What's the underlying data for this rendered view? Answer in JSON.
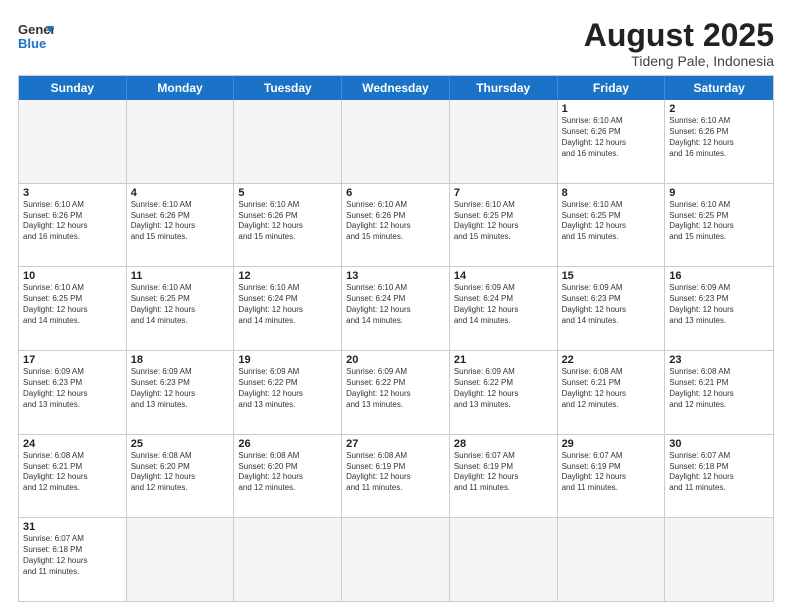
{
  "header": {
    "logo_general": "General",
    "logo_blue": "Blue",
    "month": "August 2025",
    "location": "Tideng Pale, Indonesia"
  },
  "weekdays": [
    "Sunday",
    "Monday",
    "Tuesday",
    "Wednesday",
    "Thursday",
    "Friday",
    "Saturday"
  ],
  "weeks": [
    [
      {
        "day": "",
        "info": ""
      },
      {
        "day": "",
        "info": ""
      },
      {
        "day": "",
        "info": ""
      },
      {
        "day": "",
        "info": ""
      },
      {
        "day": "",
        "info": ""
      },
      {
        "day": "1",
        "info": "Sunrise: 6:10 AM\nSunset: 6:26 PM\nDaylight: 12 hours\nand 16 minutes."
      },
      {
        "day": "2",
        "info": "Sunrise: 6:10 AM\nSunset: 6:26 PM\nDaylight: 12 hours\nand 16 minutes."
      }
    ],
    [
      {
        "day": "3",
        "info": "Sunrise: 6:10 AM\nSunset: 6:26 PM\nDaylight: 12 hours\nand 16 minutes."
      },
      {
        "day": "4",
        "info": "Sunrise: 6:10 AM\nSunset: 6:26 PM\nDaylight: 12 hours\nand 15 minutes."
      },
      {
        "day": "5",
        "info": "Sunrise: 6:10 AM\nSunset: 6:26 PM\nDaylight: 12 hours\nand 15 minutes."
      },
      {
        "day": "6",
        "info": "Sunrise: 6:10 AM\nSunset: 6:26 PM\nDaylight: 12 hours\nand 15 minutes."
      },
      {
        "day": "7",
        "info": "Sunrise: 6:10 AM\nSunset: 6:25 PM\nDaylight: 12 hours\nand 15 minutes."
      },
      {
        "day": "8",
        "info": "Sunrise: 6:10 AM\nSunset: 6:25 PM\nDaylight: 12 hours\nand 15 minutes."
      },
      {
        "day": "9",
        "info": "Sunrise: 6:10 AM\nSunset: 6:25 PM\nDaylight: 12 hours\nand 15 minutes."
      }
    ],
    [
      {
        "day": "10",
        "info": "Sunrise: 6:10 AM\nSunset: 6:25 PM\nDaylight: 12 hours\nand 14 minutes."
      },
      {
        "day": "11",
        "info": "Sunrise: 6:10 AM\nSunset: 6:25 PM\nDaylight: 12 hours\nand 14 minutes."
      },
      {
        "day": "12",
        "info": "Sunrise: 6:10 AM\nSunset: 6:24 PM\nDaylight: 12 hours\nand 14 minutes."
      },
      {
        "day": "13",
        "info": "Sunrise: 6:10 AM\nSunset: 6:24 PM\nDaylight: 12 hours\nand 14 minutes."
      },
      {
        "day": "14",
        "info": "Sunrise: 6:09 AM\nSunset: 6:24 PM\nDaylight: 12 hours\nand 14 minutes."
      },
      {
        "day": "15",
        "info": "Sunrise: 6:09 AM\nSunset: 6:23 PM\nDaylight: 12 hours\nand 14 minutes."
      },
      {
        "day": "16",
        "info": "Sunrise: 6:09 AM\nSunset: 6:23 PM\nDaylight: 12 hours\nand 13 minutes."
      }
    ],
    [
      {
        "day": "17",
        "info": "Sunrise: 6:09 AM\nSunset: 6:23 PM\nDaylight: 12 hours\nand 13 minutes."
      },
      {
        "day": "18",
        "info": "Sunrise: 6:09 AM\nSunset: 6:23 PM\nDaylight: 12 hours\nand 13 minutes."
      },
      {
        "day": "19",
        "info": "Sunrise: 6:09 AM\nSunset: 6:22 PM\nDaylight: 12 hours\nand 13 minutes."
      },
      {
        "day": "20",
        "info": "Sunrise: 6:09 AM\nSunset: 6:22 PM\nDaylight: 12 hours\nand 13 minutes."
      },
      {
        "day": "21",
        "info": "Sunrise: 6:09 AM\nSunset: 6:22 PM\nDaylight: 12 hours\nand 13 minutes."
      },
      {
        "day": "22",
        "info": "Sunrise: 6:08 AM\nSunset: 6:21 PM\nDaylight: 12 hours\nand 12 minutes."
      },
      {
        "day": "23",
        "info": "Sunrise: 6:08 AM\nSunset: 6:21 PM\nDaylight: 12 hours\nand 12 minutes."
      }
    ],
    [
      {
        "day": "24",
        "info": "Sunrise: 6:08 AM\nSunset: 6:21 PM\nDaylight: 12 hours\nand 12 minutes."
      },
      {
        "day": "25",
        "info": "Sunrise: 6:08 AM\nSunset: 6:20 PM\nDaylight: 12 hours\nand 12 minutes."
      },
      {
        "day": "26",
        "info": "Sunrise: 6:08 AM\nSunset: 6:20 PM\nDaylight: 12 hours\nand 12 minutes."
      },
      {
        "day": "27",
        "info": "Sunrise: 6:08 AM\nSunset: 6:19 PM\nDaylight: 12 hours\nand 11 minutes."
      },
      {
        "day": "28",
        "info": "Sunrise: 6:07 AM\nSunset: 6:19 PM\nDaylight: 12 hours\nand 11 minutes."
      },
      {
        "day": "29",
        "info": "Sunrise: 6:07 AM\nSunset: 6:19 PM\nDaylight: 12 hours\nand 11 minutes."
      },
      {
        "day": "30",
        "info": "Sunrise: 6:07 AM\nSunset: 6:18 PM\nDaylight: 12 hours\nand 11 minutes."
      }
    ],
    [
      {
        "day": "31",
        "info": "Sunrise: 6:07 AM\nSunset: 6:18 PM\nDaylight: 12 hours\nand 11 minutes."
      },
      {
        "day": "",
        "info": ""
      },
      {
        "day": "",
        "info": ""
      },
      {
        "day": "",
        "info": ""
      },
      {
        "day": "",
        "info": ""
      },
      {
        "day": "",
        "info": ""
      },
      {
        "day": "",
        "info": ""
      }
    ]
  ]
}
